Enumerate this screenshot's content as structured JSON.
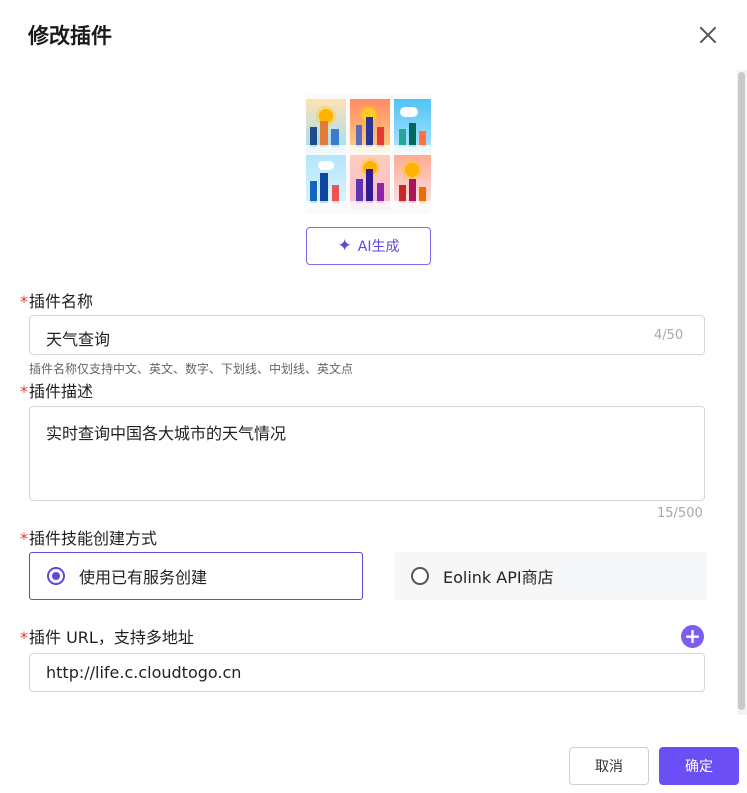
{
  "dialog": {
    "title": "修改插件",
    "ai_button_label": "AI生成",
    "name_field": {
      "label": "插件名称",
      "value": "天气查询",
      "counter": "4/50",
      "hint": "插件名称仅支持中文、英文、数字、下划线、中划线、英文点"
    },
    "desc_field": {
      "label": "插件描述",
      "value": "实时查询中国各大城市的天气情况",
      "counter": "15/500"
    },
    "method": {
      "label": "插件技能创建方式",
      "options": [
        {
          "label": "使用已有服务创建",
          "selected": true
        },
        {
          "label": "Eolink API商店",
          "selected": false
        }
      ]
    },
    "url_field": {
      "label": "插件 URL，支持多地址",
      "value": "http://life.c.cloudtogo.cn"
    },
    "cancel_label": "取消",
    "confirm_label": "确定"
  },
  "colors": {
    "accent": "#6c4ef5",
    "required": "#e53935"
  }
}
